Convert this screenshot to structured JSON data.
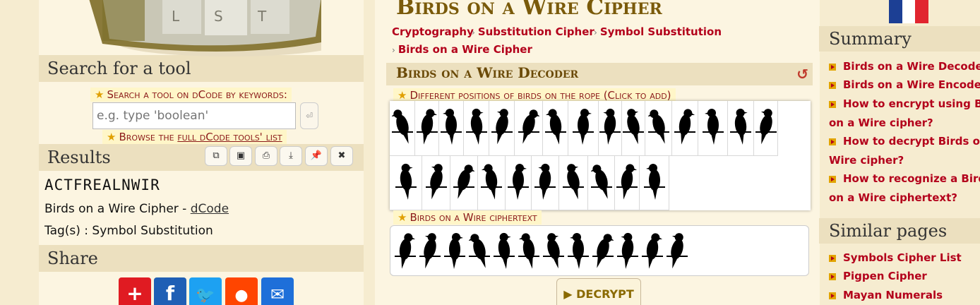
{
  "left": {
    "search_heading": "Search for a tool",
    "search_hint": "Search a tool on dCode by keywords:",
    "search_placeholder": "e.g. type 'boolean'",
    "browse_prefix": "Browse the ",
    "browse_link": "full dCode tools' list",
    "results_heading": "Results",
    "toolbar": [
      "copy-icon",
      "save-icon",
      "print-icon",
      "download-icon",
      "pin-icon",
      "close-icon"
    ],
    "result_value": "ACTFREALNWIR",
    "result_source_prefix": "Birds on a Wire Cipher - ",
    "result_source_link": "dCode",
    "result_tags": "Tag(s) : Symbol Substitution",
    "share_heading": "Share",
    "share_colors": {
      "addthis": "#e01b22",
      "facebook": "#1f5fb5",
      "twitter": "#1da1f2",
      "reddit": "#ff4500",
      "email": "#1e6fd9"
    }
  },
  "center": {
    "page_title": "Birds on a Wire Cipher",
    "breadcrumb": [
      "Cryptography",
      "Substitution Cipher",
      "Symbol Substitution",
      "Birds on a Wire Cipher"
    ],
    "decoder_title": "Birds on a Wire Decoder",
    "positions_label": "Different positions of birds on the rope (Click to add)",
    "ciphertext_label": "Birds on a Wire ciphertext",
    "decrypt_label": "▶ DECRYPT"
  },
  "right": {
    "summary_heading": "Summary",
    "summary_links": [
      "Birds on a Wire Decoder",
      "Birds on a Wire Encoder",
      "How to encrypt using Birds on a Wire cipher?",
      "How to decrypt Birds on a Wire cipher?",
      "How to recognize a Birds on a Wire ciphertext?"
    ],
    "similar_heading": "Similar pages",
    "similar_links": [
      "Symbols Cipher List",
      "Pigpen Cipher",
      "Mayan Numerals"
    ]
  }
}
